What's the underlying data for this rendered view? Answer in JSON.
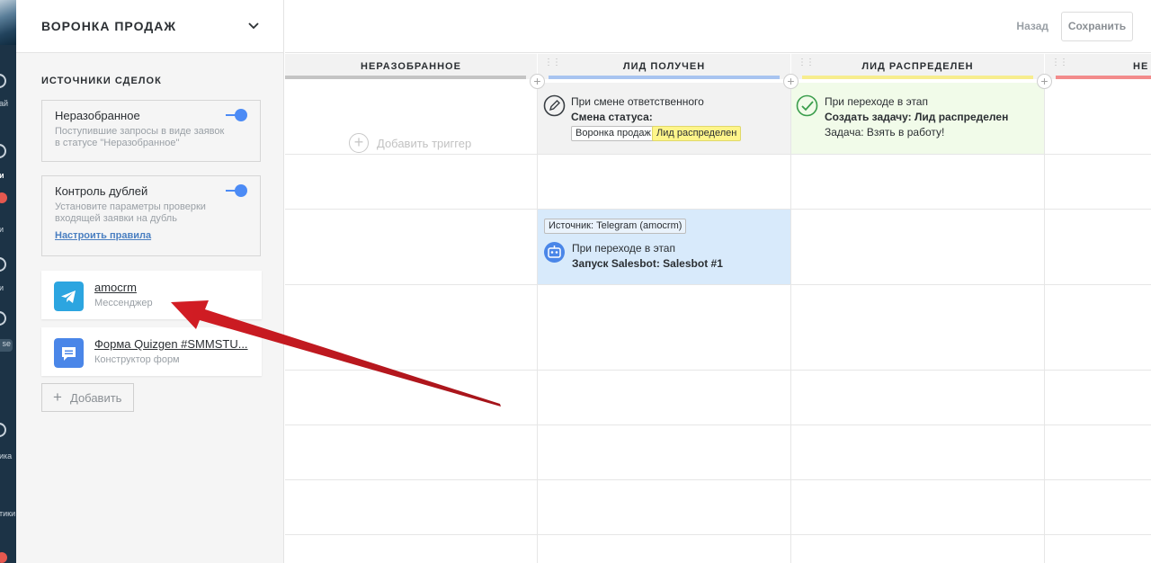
{
  "nav": {
    "badge": "1",
    "pill": "se",
    "labels": [
      "ай",
      "и",
      "и",
      "и",
      "ика",
      "тики"
    ]
  },
  "panel": {
    "title": "ВОРОНКА ПРОДАЖ",
    "sources_title": "ИСТОЧНИКИ СДЕЛОК",
    "unsorted": {
      "name": "Неразобранное",
      "desc": "Поступившие запросы в виде заявок в статусе \"Неразобранное\"",
      "enabled": true
    },
    "duplicates": {
      "name": "Контроль дублей",
      "desc": "Установите параметры проверки входящей заявки на дубль",
      "link": "Настроить правила",
      "enabled": true
    },
    "integrations": [
      {
        "name": "amocrm",
        "type": "Мессенджер",
        "icon": "telegram-icon",
        "color": "#2ca5e0"
      },
      {
        "name": "Форма Quizgen #SMMSTU...",
        "type": "Конструктор форм",
        "icon": "form-chat-icon",
        "color": "#4a86e8"
      }
    ],
    "add_label": "Добавить"
  },
  "topbar": {
    "back": "Назад",
    "save": "Сохранить"
  },
  "columns": [
    {
      "title": "НЕРАЗОБРАННОЕ",
      "color": "#c4c4c4"
    },
    {
      "title": "ЛИД ПОЛУЧЕН",
      "color": "#a8c4f0"
    },
    {
      "title": "ЛИД РАСПРЕДЕЛЕН",
      "color": "#f7ed8e"
    },
    {
      "title": "НЕ",
      "color": "#f28b8b"
    }
  ],
  "triggers": {
    "add_trigger": "Добавить триггер",
    "resp_change": {
      "line1": "При смене ответственного",
      "line2": "Смена статуса:",
      "tag1": "Воронка продаж",
      "tag2": "Лид распределен"
    },
    "create_task": {
      "line1": "При переходе в этап",
      "line2": "Создать задачу: Лид распределен",
      "line3": "Задача: Взять в работу!"
    },
    "salesbot": {
      "source": "Источник: Telegram (amocrm)",
      "line1": "При переходе в этап",
      "line2": "Запуск Salesbot: Salesbot #1"
    }
  },
  "colors": {
    "accent": "#4c8bf5",
    "arrow": "#c9141a",
    "salesbot_bg": "#d8eafb",
    "task_bg": "#f1fbe9",
    "resp_bg": "#f2f2f2"
  }
}
